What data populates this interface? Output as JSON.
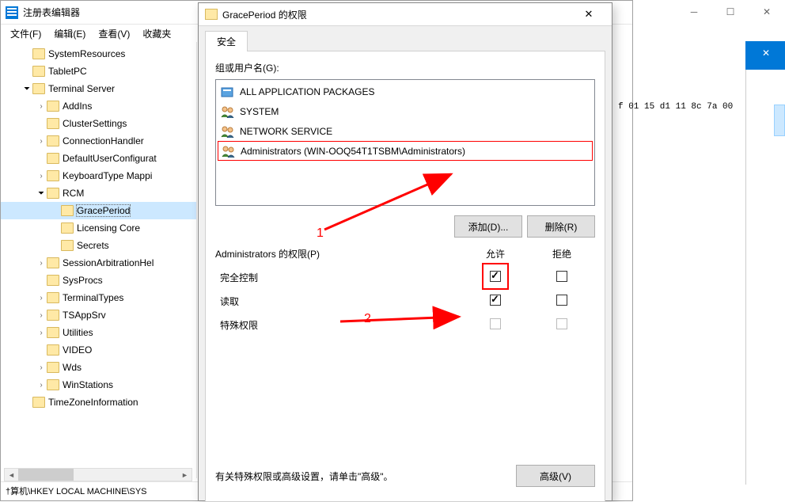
{
  "regedit": {
    "title": "注册表编辑器",
    "menu": {
      "file": "文件(F)",
      "edit": "编辑(E)",
      "view": "查看(V)",
      "favorites": "收藏夹"
    },
    "tree": [
      {
        "level": 1,
        "chevron": "",
        "label": "SystemResources"
      },
      {
        "level": 1,
        "chevron": "",
        "label": "TabletPC"
      },
      {
        "level": 1,
        "chevron": "open",
        "label": "Terminal Server"
      },
      {
        "level": 2,
        "chevron": "closed",
        "label": "AddIns"
      },
      {
        "level": 2,
        "chevron": "",
        "label": "ClusterSettings"
      },
      {
        "level": 2,
        "chevron": "closed",
        "label": "ConnectionHandler"
      },
      {
        "level": 2,
        "chevron": "",
        "label": "DefaultUserConfigurat"
      },
      {
        "level": 2,
        "chevron": "closed",
        "label": "KeyboardType Mappi"
      },
      {
        "level": 2,
        "chevron": "open",
        "label": "RCM"
      },
      {
        "level": 3,
        "chevron": "",
        "label": "GracePeriod",
        "selected": true
      },
      {
        "level": 3,
        "chevron": "",
        "label": "Licensing Core"
      },
      {
        "level": 3,
        "chevron": "",
        "label": "Secrets"
      },
      {
        "level": 2,
        "chevron": "closed",
        "label": "SessionArbitrationHel"
      },
      {
        "level": 2,
        "chevron": "",
        "label": "SysProcs"
      },
      {
        "level": 2,
        "chevron": "closed",
        "label": "TerminalTypes"
      },
      {
        "level": 2,
        "chevron": "closed",
        "label": "TSAppSrv"
      },
      {
        "level": 2,
        "chevron": "closed",
        "label": "Utilities"
      },
      {
        "level": 2,
        "chevron": "",
        "label": "VIDEO"
      },
      {
        "level": 2,
        "chevron": "closed",
        "label": "Wds"
      },
      {
        "level": 2,
        "chevron": "closed",
        "label": "WinStations"
      },
      {
        "level": 1,
        "chevron": "",
        "label": "TimeZoneInformation"
      }
    ],
    "data_value": "f 01 15 d1 11 8c 7a 00",
    "status": "†算机\\HKEY LOCAL MACHINE\\SYS"
  },
  "perm_dialog": {
    "title": "GracePeriod 的权限",
    "tab_security": "安全",
    "groups_label": "组或用户名(G):",
    "groups": [
      {
        "label": "ALL APPLICATION PACKAGES",
        "icon": "package"
      },
      {
        "label": "SYSTEM",
        "icon": "users"
      },
      {
        "label": "NETWORK SERVICE",
        "icon": "users"
      },
      {
        "label": "Administrators (WIN-OOQ54T1TSBM\\Administrators)",
        "icon": "users",
        "selected": true
      }
    ],
    "add_btn": "添加(D)...",
    "remove_btn": "删除(R)",
    "perms_for": "Administrators 的权限(P)",
    "col_allow": "允许",
    "col_deny": "拒绝",
    "perms": [
      {
        "name": "完全控制",
        "allow": true,
        "allow_highlight": true,
        "deny": false
      },
      {
        "name": "读取",
        "allow": true,
        "deny": false
      },
      {
        "name": "特殊权限",
        "allow": false,
        "allow_disabled": true,
        "deny": false,
        "deny_disabled": true
      }
    ],
    "advanced_text": "有关特殊权限或高级设置，请单击\"高级\"。",
    "advanced_btn": "高级(V)"
  },
  "annotations": {
    "one": "1",
    "two": "2"
  }
}
